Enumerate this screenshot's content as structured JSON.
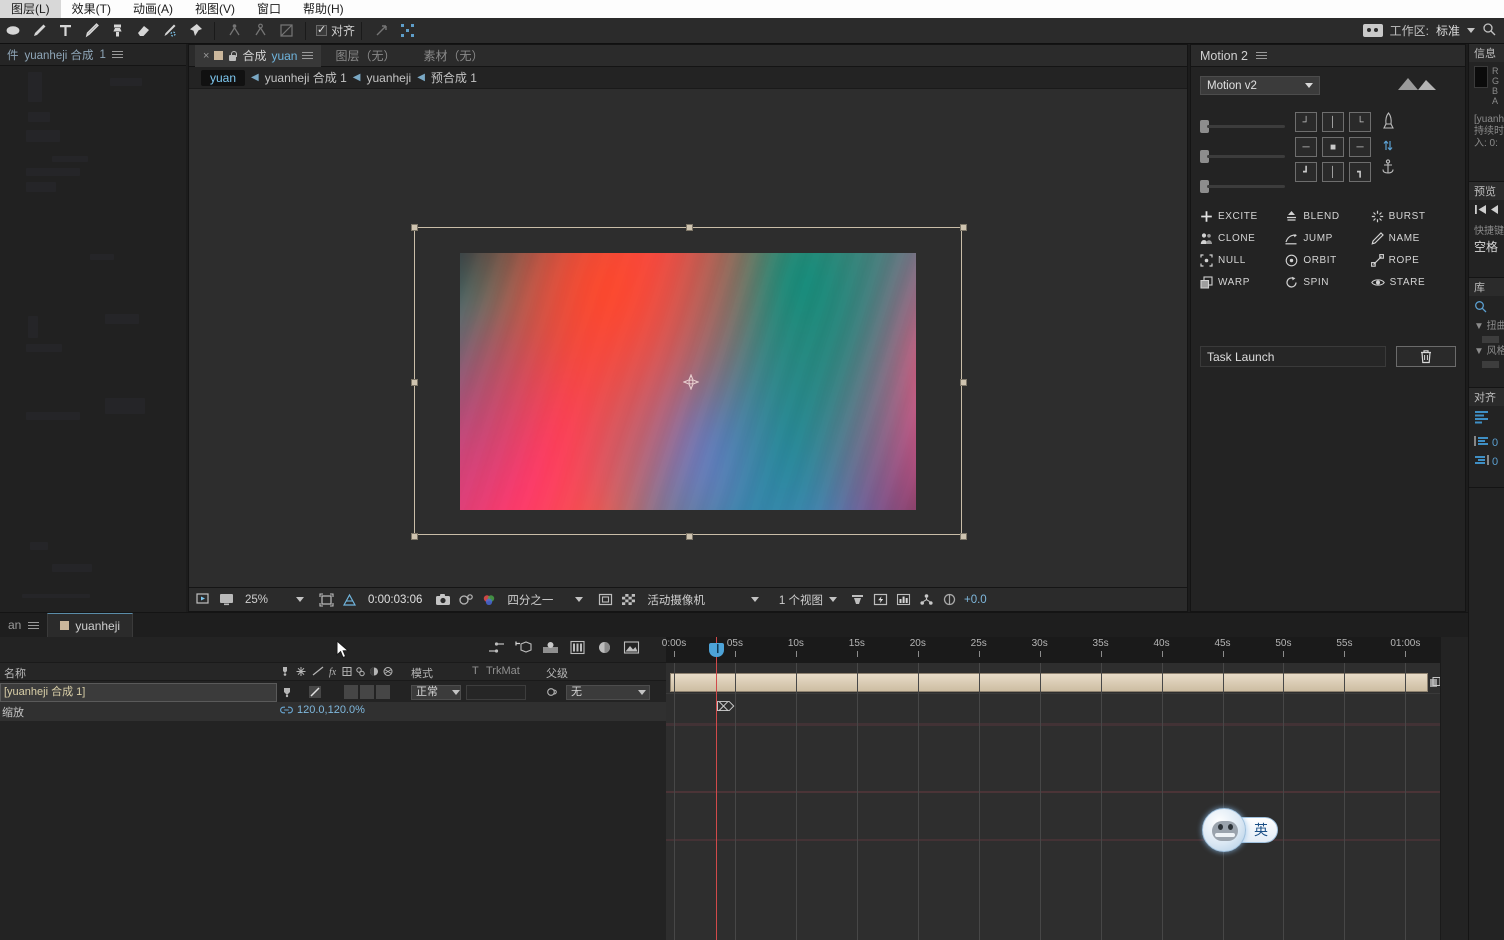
{
  "menubar": {
    "items": [
      "图层(L)",
      "效果(T)",
      "动画(A)",
      "视图(V)",
      "窗口",
      "帮助(H)"
    ]
  },
  "toolbar": {
    "tools": [
      {
        "name": "shape-tool",
        "label": "形状工具"
      },
      {
        "name": "pen-tool",
        "label": "钢笔工具"
      },
      {
        "name": "text-tool",
        "label": "文字工具"
      },
      {
        "name": "brush-tool",
        "label": "画笔工具"
      },
      {
        "name": "clone-stamp-tool",
        "label": "仿制图章工具"
      },
      {
        "name": "eraser-tool",
        "label": "橡皮擦工具"
      },
      {
        "name": "roto-brush-tool",
        "label": "Roto 笔刷工具"
      },
      {
        "name": "puppet-pin-tool",
        "label": "人偶位置控点工具"
      }
    ],
    "rigging": [
      {
        "name": "puppet-starch-tool",
        "label": "人偶固化控点"
      },
      {
        "name": "puppet-overlap-tool",
        "label": "人偶重叠控点"
      },
      {
        "name": "puppet-advanced-tool",
        "label": "人偶高级控点"
      }
    ],
    "snap_label": "对齐",
    "snap_checked": true,
    "workspace_label": "工作区:",
    "workspace_value": "标准"
  },
  "project_panel": {
    "tab_label_partial": "件",
    "tab_name": "yuanheji 合成",
    "tab_index": "1"
  },
  "comp_panel": {
    "tabs": {
      "close": "×",
      "comp_prefix": "合成",
      "comp_name": "yuan",
      "layer_tab": "图层（无）",
      "footage_tab": "素材（无）"
    },
    "breadcrumb": [
      "yuan",
      "yuanheji 合成 1",
      "yuanheji",
      "预合成 1"
    ],
    "viewer_bar": {
      "zoom": "25%",
      "time": "0:00:03:06",
      "resolution": "四分之一",
      "camera": "活动摄像机",
      "views": "1 个视图",
      "exposure": "+0.0"
    }
  },
  "motion_panel": {
    "title": "Motion 2",
    "version_select": "Motion v2",
    "buttons": [
      {
        "label": "EXCITE",
        "icon": "plus-icon"
      },
      {
        "label": "BLEND",
        "icon": "blend-icon"
      },
      {
        "label": "BURST",
        "icon": "burst-icon"
      },
      {
        "label": "CLONE",
        "icon": "clone-icon"
      },
      {
        "label": "JUMP",
        "icon": "jump-icon"
      },
      {
        "label": "NAME",
        "icon": "pencil-icon"
      },
      {
        "label": "NULL",
        "icon": "null-icon"
      },
      {
        "label": "ORBIT",
        "icon": "orbit-icon"
      },
      {
        "label": "ROPE",
        "icon": "rope-icon"
      },
      {
        "label": "WARP",
        "icon": "warp-icon"
      },
      {
        "label": "SPIN",
        "icon": "spin-icon"
      },
      {
        "label": "STARE",
        "icon": "eye-icon"
      }
    ],
    "task_select": "Task Launch",
    "delete_icon": "trash-icon"
  },
  "right_rail": {
    "info_title": "信息",
    "info_rgb": [
      "R",
      "G",
      "B",
      "A"
    ],
    "info_lines": [
      "[yuanh",
      "持续时",
      "入: 0:"
    ],
    "preview_title": "预览",
    "shortcut_label": "快捷键",
    "shortcut_value": "空格",
    "library_title": "库",
    "effects": [
      "▼ 扭曲",
      "▼ 风格"
    ],
    "align_title": "对齐",
    "align_values": [
      "0",
      "0"
    ]
  },
  "timeline": {
    "tab_partial": "an",
    "tab_name": "yuanheji",
    "columns": [
      "名称",
      "模式",
      "T",
      "TrkMat",
      "父级"
    ],
    "layers": [
      {
        "name": "[yuanheji 合成 1]",
        "mode": "正常",
        "trkmat": "",
        "parent": "无",
        "property_label": "缩放",
        "property_value": "120.0,120.0%"
      }
    ],
    "ruler_labels": [
      "0:00s",
      "05s",
      "10s",
      "15s",
      "20s",
      "25s",
      "30s",
      "35s",
      "40s",
      "45s",
      "50s",
      "55s",
      "01:00s"
    ],
    "ruler_seconds": [
      0,
      5,
      10,
      15,
      20,
      25,
      30,
      35,
      40,
      45,
      50,
      55,
      60
    ]
  },
  "ime": {
    "mode_label": "英"
  },
  "colors": {
    "accent_blue": "#6fb4dd",
    "layer_bar": "#d9c9ae",
    "cti_red": "#d04a4a",
    "panel_bg": "#232323"
  }
}
